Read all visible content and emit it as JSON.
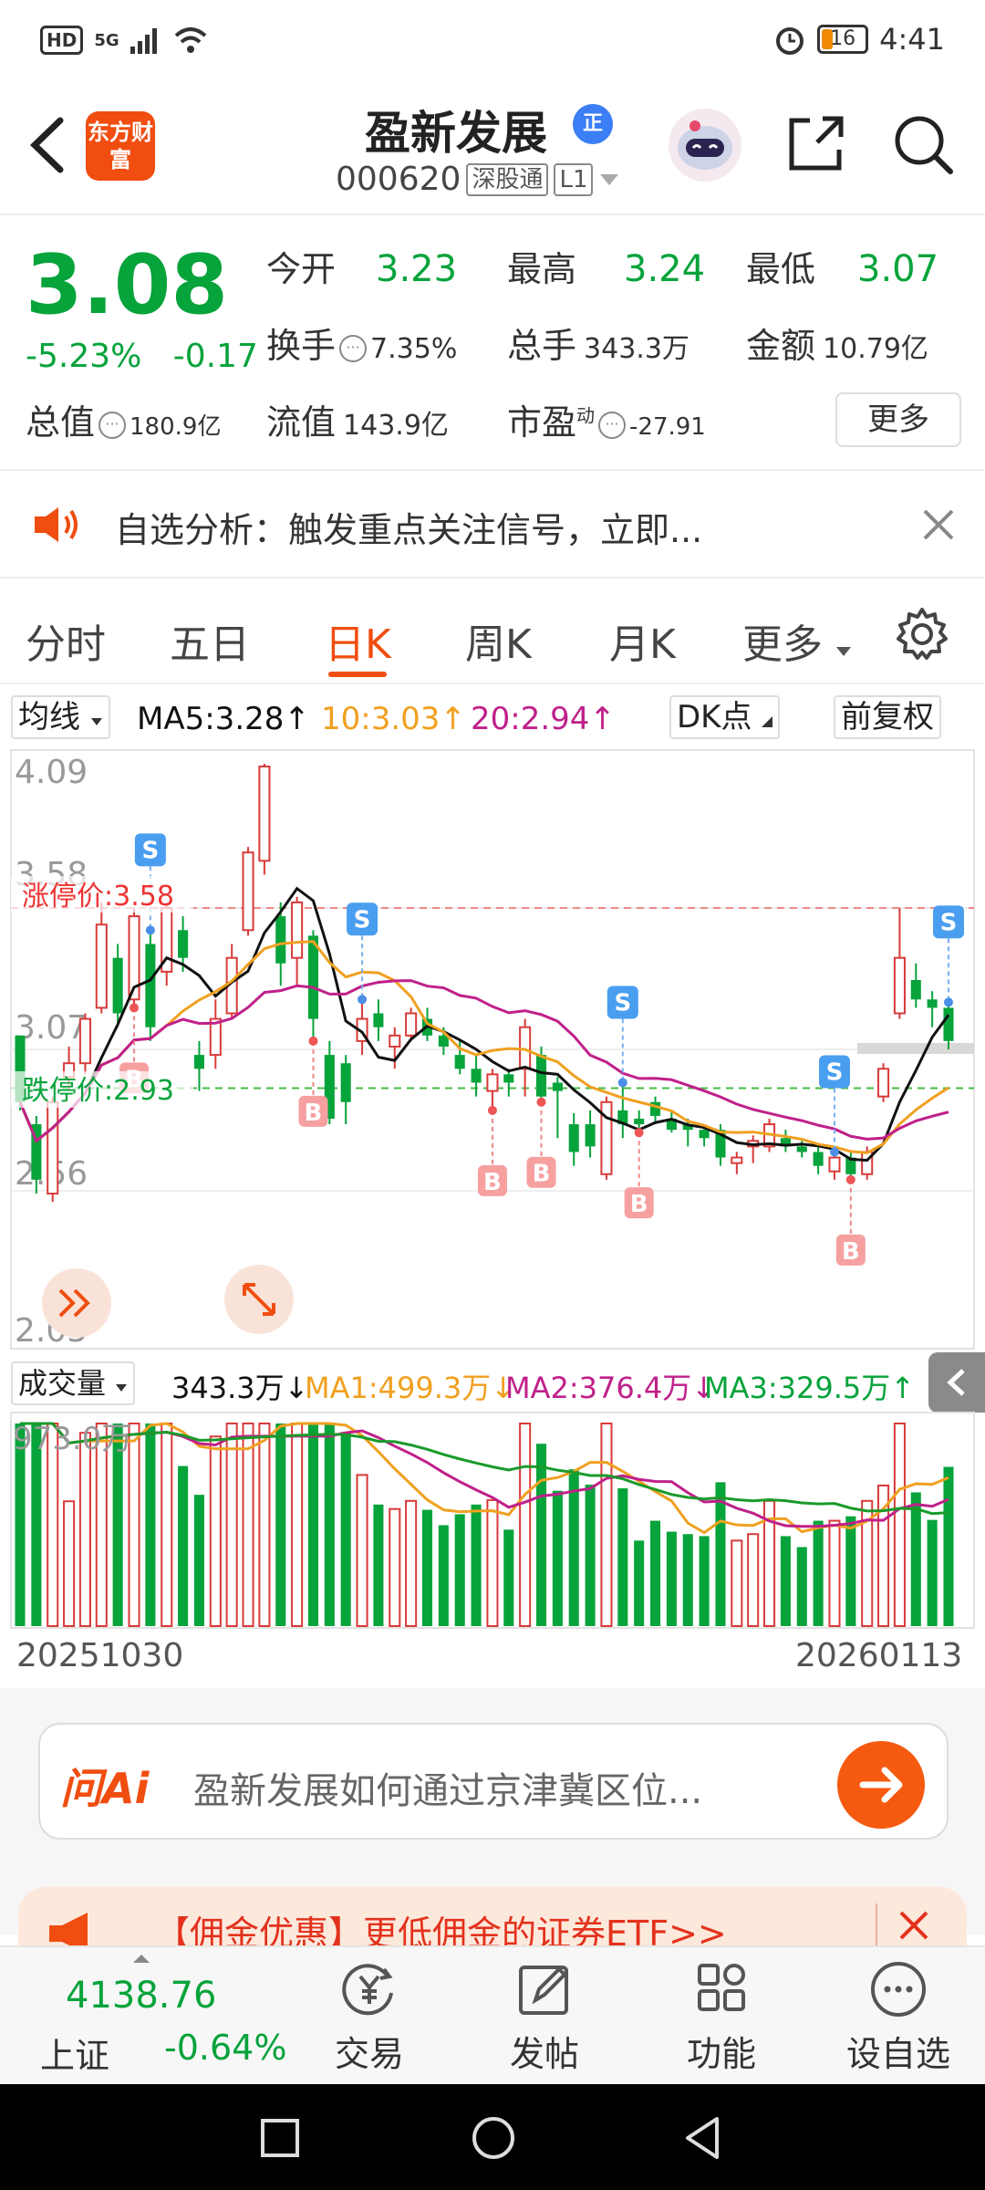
{
  "status_bar": {
    "network": "HD",
    "signal": "5G",
    "battery": "16",
    "time": "4:41"
  },
  "header": {
    "app_logo": "东方财富",
    "stock_name": "盈新发展",
    "zheng_badge": "正",
    "stock_code": "000620",
    "market_tag": "深股通",
    "level_tag": "L1"
  },
  "quote": {
    "price": "3.08",
    "change_pct": "-5.23%",
    "change_abs": "-0.17",
    "open_label": "今开",
    "open": "3.23",
    "high_label": "最高",
    "high": "3.24",
    "low_label": "最低",
    "low": "3.07",
    "turnover_label": "换手",
    "turnover": "7.35%",
    "volume_label": "总手",
    "volume": "343.3万",
    "amount_label": "金额",
    "amount": "10.79亿",
    "mktcap_label": "总值",
    "mktcap": "180.9亿",
    "float_label": "流值",
    "float": "143.9亿",
    "pe_label": "市盈",
    "pe_sup": "动",
    "pe": "-27.91",
    "more": "更多"
  },
  "notice": {
    "text": "自选分析：触发重点关注信号，立即..."
  },
  "tabs": [
    "分时",
    "五日",
    "日K",
    "周K",
    "月K",
    "更多"
  ],
  "ma_bar": {
    "select": "均线",
    "ma5": "MA5:3.28↑",
    "ma10": "10:3.03↑",
    "ma20": "20:2.94↑",
    "dk": "DK点",
    "adjust": "前复权"
  },
  "chart_labels": {
    "y_top": "4.09",
    "y_mid1": "3.58",
    "y_mid2": "3.07",
    "y_mid3": "2.56",
    "y_bottom": "2.05",
    "limit_up": "涨停价:3.58",
    "limit_down": "跌停价:2.93",
    "s": "S",
    "b": "B"
  },
  "volume_bar": {
    "select": "成交量",
    "vol": "343.3万↓",
    "ma1": "MA1:499.3万↓",
    "ma2": "MA2:376.4万↓",
    "ma3": "MA3:329.5万↑",
    "max_label": "973.0万"
  },
  "dates": {
    "start": "20251030",
    "end": "20260113"
  },
  "ai": {
    "logo": "问Ai",
    "text": "盈新发展如何通过京津冀区位..."
  },
  "promo": {
    "text": "【佣金优惠】更低佣金的证券ETF>>"
  },
  "bottom": {
    "index_value": "4138.76",
    "index_name": "上证",
    "index_change": "-0.64%",
    "nav": [
      "交易",
      "发帖",
      "功能",
      "设自选"
    ]
  },
  "colors": {
    "up": "#d93a3a",
    "down": "#07a33b",
    "accent": "#f04d10",
    "ma5": "#111111",
    "ma10": "#f0a020",
    "ma20": "#c0208a"
  },
  "chart_data": {
    "type": "candlestick",
    "y_axis_ticks": [
      4.09,
      3.58,
      3.07,
      2.56,
      2.05
    ],
    "limit_up": 3.58,
    "limit_down": 2.93,
    "x_start": "20251030",
    "x_end": "20260113",
    "candles": [
      [
        3.12,
        2.88,
        3.12,
        2.85
      ],
      [
        2.8,
        2.6,
        2.83,
        2.55
      ],
      [
        2.55,
        2.88,
        2.9,
        2.52
      ],
      [
        2.97,
        3.02,
        3.08,
        2.92
      ],
      [
        3.02,
        3.18,
        3.2,
        2.98
      ],
      [
        3.22,
        3.52,
        3.6,
        3.2
      ],
      [
        3.4,
        3.2,
        3.45,
        3.15
      ],
      [
        3.25,
        3.55,
        3.58,
        3.22
      ],
      [
        3.45,
        3.15,
        3.5,
        3.1
      ],
      [
        3.35,
        3.58,
        3.6,
        3.3
      ],
      [
        3.5,
        3.4,
        3.55,
        3.35
      ],
      [
        3.05,
        3.0,
        3.1,
        2.92
      ],
      [
        3.05,
        3.18,
        3.25,
        3.0
      ],
      [
        3.2,
        3.4,
        3.45,
        3.18
      ],
      [
        3.5,
        3.78,
        3.8,
        3.48
      ],
      [
        3.75,
        4.09,
        4.1,
        3.7
      ],
      [
        3.55,
        3.38,
        3.6,
        3.3
      ],
      [
        3.4,
        3.6,
        3.62,
        3.3
      ],
      [
        3.48,
        3.18,
        3.5,
        3.1
      ],
      [
        3.05,
        2.82,
        3.1,
        2.8
      ],
      [
        3.02,
        2.88,
        3.05,
        2.8
      ],
      [
        3.1,
        3.18,
        3.25,
        3.05
      ],
      [
        3.2,
        3.15,
        3.25,
        3.1
      ],
      [
        3.08,
        3.12,
        3.15,
        3.0
      ],
      [
        3.12,
        3.2,
        3.22,
        3.1
      ],
      [
        3.18,
        3.12,
        3.22,
        3.1
      ],
      [
        3.12,
        3.08,
        3.15,
        3.05
      ],
      [
        3.05,
        3.0,
        3.1,
        2.98
      ],
      [
        3.0,
        2.95,
        3.05,
        2.9
      ],
      [
        2.92,
        2.98,
        3.0,
        2.85
      ],
      [
        2.98,
        2.95,
        3.0,
        2.9
      ],
      [
        3.0,
        3.15,
        3.18,
        2.9
      ],
      [
        3.05,
        2.9,
        3.08,
        2.88
      ],
      [
        2.95,
        2.92,
        2.97,
        2.75
      ],
      [
        2.8,
        2.7,
        2.84,
        2.65
      ],
      [
        2.8,
        2.72,
        2.85,
        2.68
      ],
      [
        2.62,
        2.88,
        2.9,
        2.6
      ],
      [
        2.85,
        2.8,
        2.95,
        2.75
      ],
      [
        2.82,
        2.8,
        2.85,
        2.77
      ],
      [
        2.88,
        2.83,
        2.9,
        2.8
      ],
      [
        2.82,
        2.78,
        2.85,
        2.77
      ],
      [
        2.8,
        2.78,
        2.82,
        2.72
      ],
      [
        2.78,
        2.75,
        2.8,
        2.72
      ],
      [
        2.78,
        2.68,
        2.8,
        2.65
      ],
      [
        2.66,
        2.68,
        2.7,
        2.62
      ],
      [
        2.72,
        2.74,
        2.76,
        2.66
      ],
      [
        2.72,
        2.8,
        2.82,
        2.7
      ],
      [
        2.75,
        2.72,
        2.78,
        2.7
      ],
      [
        2.72,
        2.7,
        2.74,
        2.68
      ],
      [
        2.7,
        2.65,
        2.72,
        2.62
      ],
      [
        2.63,
        2.68,
        2.7,
        2.6
      ],
      [
        2.68,
        2.62,
        2.7,
        2.6
      ],
      [
        2.62,
        2.7,
        2.72,
        2.6
      ],
      [
        2.9,
        3.0,
        3.02,
        2.88
      ],
      [
        3.2,
        3.4,
        3.58,
        3.18
      ],
      [
        3.32,
        3.25,
        3.38,
        3.22
      ],
      [
        3.25,
        3.22,
        3.28,
        3.15
      ],
      [
        3.22,
        3.1,
        3.24,
        3.07
      ]
    ]
  }
}
